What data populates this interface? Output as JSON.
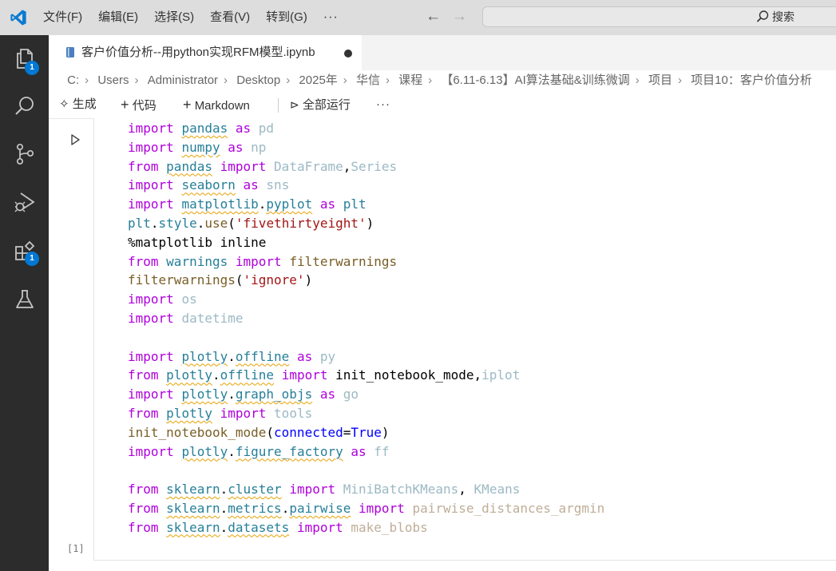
{
  "menu": {
    "items": [
      "文件(F)",
      "编辑(E)",
      "选择(S)",
      "查看(V)",
      "转到(G)"
    ],
    "more": "···"
  },
  "search": {
    "label": "搜索"
  },
  "activity": {
    "explorer_badge": "1",
    "extensions_badge": "1"
  },
  "tab": {
    "title": "客户价值分析--用python实现RFM模型.ipynb"
  },
  "breadcrumb": [
    "C:",
    "Users",
    "Administrator",
    "Desktop",
    "2025年",
    "华信",
    "课程",
    "【6.11-6.13】AI算法基础&训练微调",
    "项目",
    "项目10：客户价值分析"
  ],
  "toolbar": {
    "generate": "生成",
    "code": "代码",
    "markdown": "Markdown",
    "run_all": "全部运行",
    "more": "···"
  },
  "cell": {
    "execution_count": "[1]",
    "code_lines": [
      "import pandas as pd",
      "import numpy as np",
      "from pandas import DataFrame,Series",
      "import seaborn as sns",
      "import matplotlib.pyplot as plt",
      "plt.style.use('fivethirtyeight')",
      "%matplotlib inline",
      "from warnings import filterwarnings",
      "filterwarnings('ignore')",
      "import os",
      "import datetime",
      "",
      "import plotly.offline as py",
      "from plotly.offline import init_notebook_mode,iplot",
      "import plotly.graph_objs as go",
      "from plotly import tools",
      "init_notebook_mode(connected=True)",
      "import plotly.figure_factory as ff",
      "",
      "from sklearn.cluster import MiniBatchKMeans, KMeans",
      "from sklearn.metrics.pairwise import pairwise_distances_argmin",
      "from sklearn.datasets import make_blobs"
    ]
  }
}
